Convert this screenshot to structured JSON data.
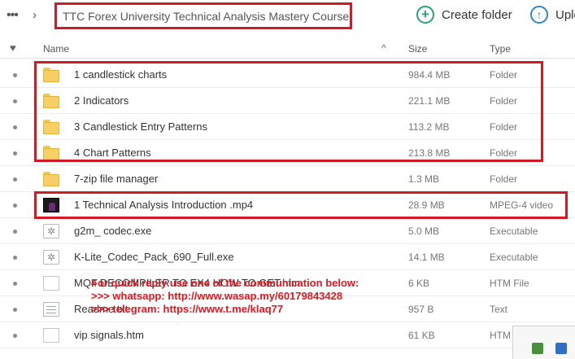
{
  "toolbar": {
    "breadcrumb": "TTC Forex University Technical Analysis Mastery Course",
    "create_folder": "Create folder",
    "upload": "Uplo"
  },
  "columns": {
    "name": "Name",
    "size": "Size",
    "type": "Type"
  },
  "files": [
    {
      "name": "1 candlestick charts",
      "size": "984.4 MB",
      "type": "Folder",
      "icon": "folder-icon"
    },
    {
      "name": "2 Indicators",
      "size": "221.1 MB",
      "type": "Folder",
      "icon": "folder-icon"
    },
    {
      "name": "3 Candlestick Entry Patterns",
      "size": "113.2 MB",
      "type": "Folder",
      "icon": "folder-icon"
    },
    {
      "name": "4 Chart Patterns",
      "size": "213.8 MB",
      "type": "Folder",
      "icon": "folder-icon"
    },
    {
      "name": "7-zip file manager",
      "size": "1.3 MB",
      "type": "Folder",
      "icon": "folder-icon"
    },
    {
      "name": "1 Technical Analysis Introduction .mp4",
      "size": "28.9 MB",
      "type": "MPEG-4 video",
      "icon": "video-icon"
    },
    {
      "name": "g2m_ codec.exe",
      "size": "5.0 MB",
      "type": "Executable",
      "icon": "exe-icon"
    },
    {
      "name": "K-Lite_Codec_Pack_690_Full.exe",
      "size": "14.1 MB",
      "type": "Executable",
      "icon": "exe-icon"
    },
    {
      "name": "MQ4 DECOMPILER TO EX4 HOW TO GET.htm",
      "size": "6 KB",
      "type": "HTM File",
      "icon": "document-icon"
    },
    {
      "name": "Readme.txt",
      "size": "957 B",
      "type": "Text",
      "icon": "text-file-icon"
    },
    {
      "name": "vip signals.htm",
      "size": "61 KB",
      "type": "HTM",
      "icon": "document-icon"
    }
  ],
  "overlay": {
    "line1": "For quick reply use one of the communication below:",
    "line2": ">>> whatsapp: http://www.wasap.my/60179843428",
    "line3": ">>> telegram: https://www.t.me/klaq77"
  },
  "colors": {
    "highlight": "#d11a24",
    "create": "#27a36b",
    "upload": "#2f86c8",
    "overlay_text": "#e8141e"
  }
}
